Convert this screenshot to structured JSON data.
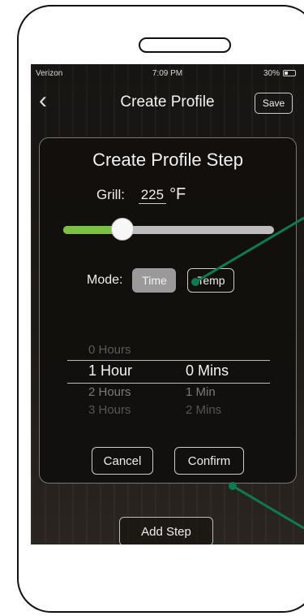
{
  "status_bar": {
    "carrier": "Verizon",
    "time": "7:09 PM",
    "battery": "30%"
  },
  "nav": {
    "back_icon": "chevron-left-icon",
    "title": "Create Profile",
    "save_label": "Save"
  },
  "modal": {
    "title": "Create Profile Step",
    "grill_label": "Grill:",
    "grill_value": "225",
    "grill_unit": "°F",
    "temperature_slider_fraction": 0.28,
    "mode_label": "Mode:",
    "mode_time_label": "Time",
    "mode_temp_label": "Temp",
    "picker": {
      "hours": [
        "0 Hours",
        "1 Hour",
        "2 Hours",
        "3 Hours"
      ],
      "minutes": [
        "",
        "0 Mins",
        "1 Min",
        "2 Mins"
      ]
    },
    "cancel_label": "Cancel",
    "confirm_label": "Confirm"
  },
  "add_step_label": "Add Step",
  "colors": {
    "accent": "#7cc242",
    "callout": "#0e7a4f"
  }
}
